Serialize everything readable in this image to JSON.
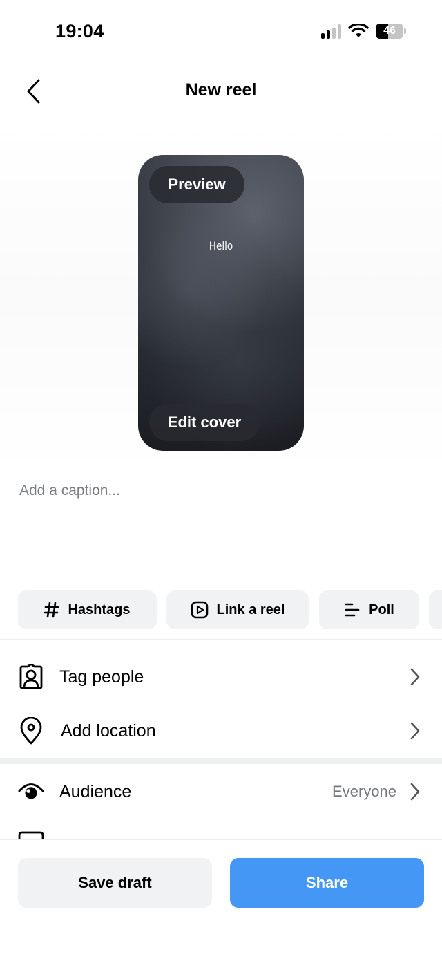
{
  "status_bar": {
    "time": "19:04",
    "battery": "46",
    "battery_level": 0.46
  },
  "header": {
    "title": "New reel"
  },
  "preview": {
    "preview_label": "Preview",
    "reel_text": "Hello",
    "edit_cover_label": "Edit cover"
  },
  "caption": {
    "placeholder": "Add a caption..."
  },
  "chips": {
    "hashtags": "Hashtags",
    "link_reel": "Link a reel",
    "poll": "Poll"
  },
  "rows": {
    "tag_people": "Tag people",
    "add_location": "Add location",
    "audience": "Audience",
    "audience_value": "Everyone"
  },
  "footer": {
    "save_draft": "Save draft",
    "share": "Share"
  },
  "colors": {
    "share_blue": "#4597f6",
    "chip_bg": "#f1f2f4"
  }
}
